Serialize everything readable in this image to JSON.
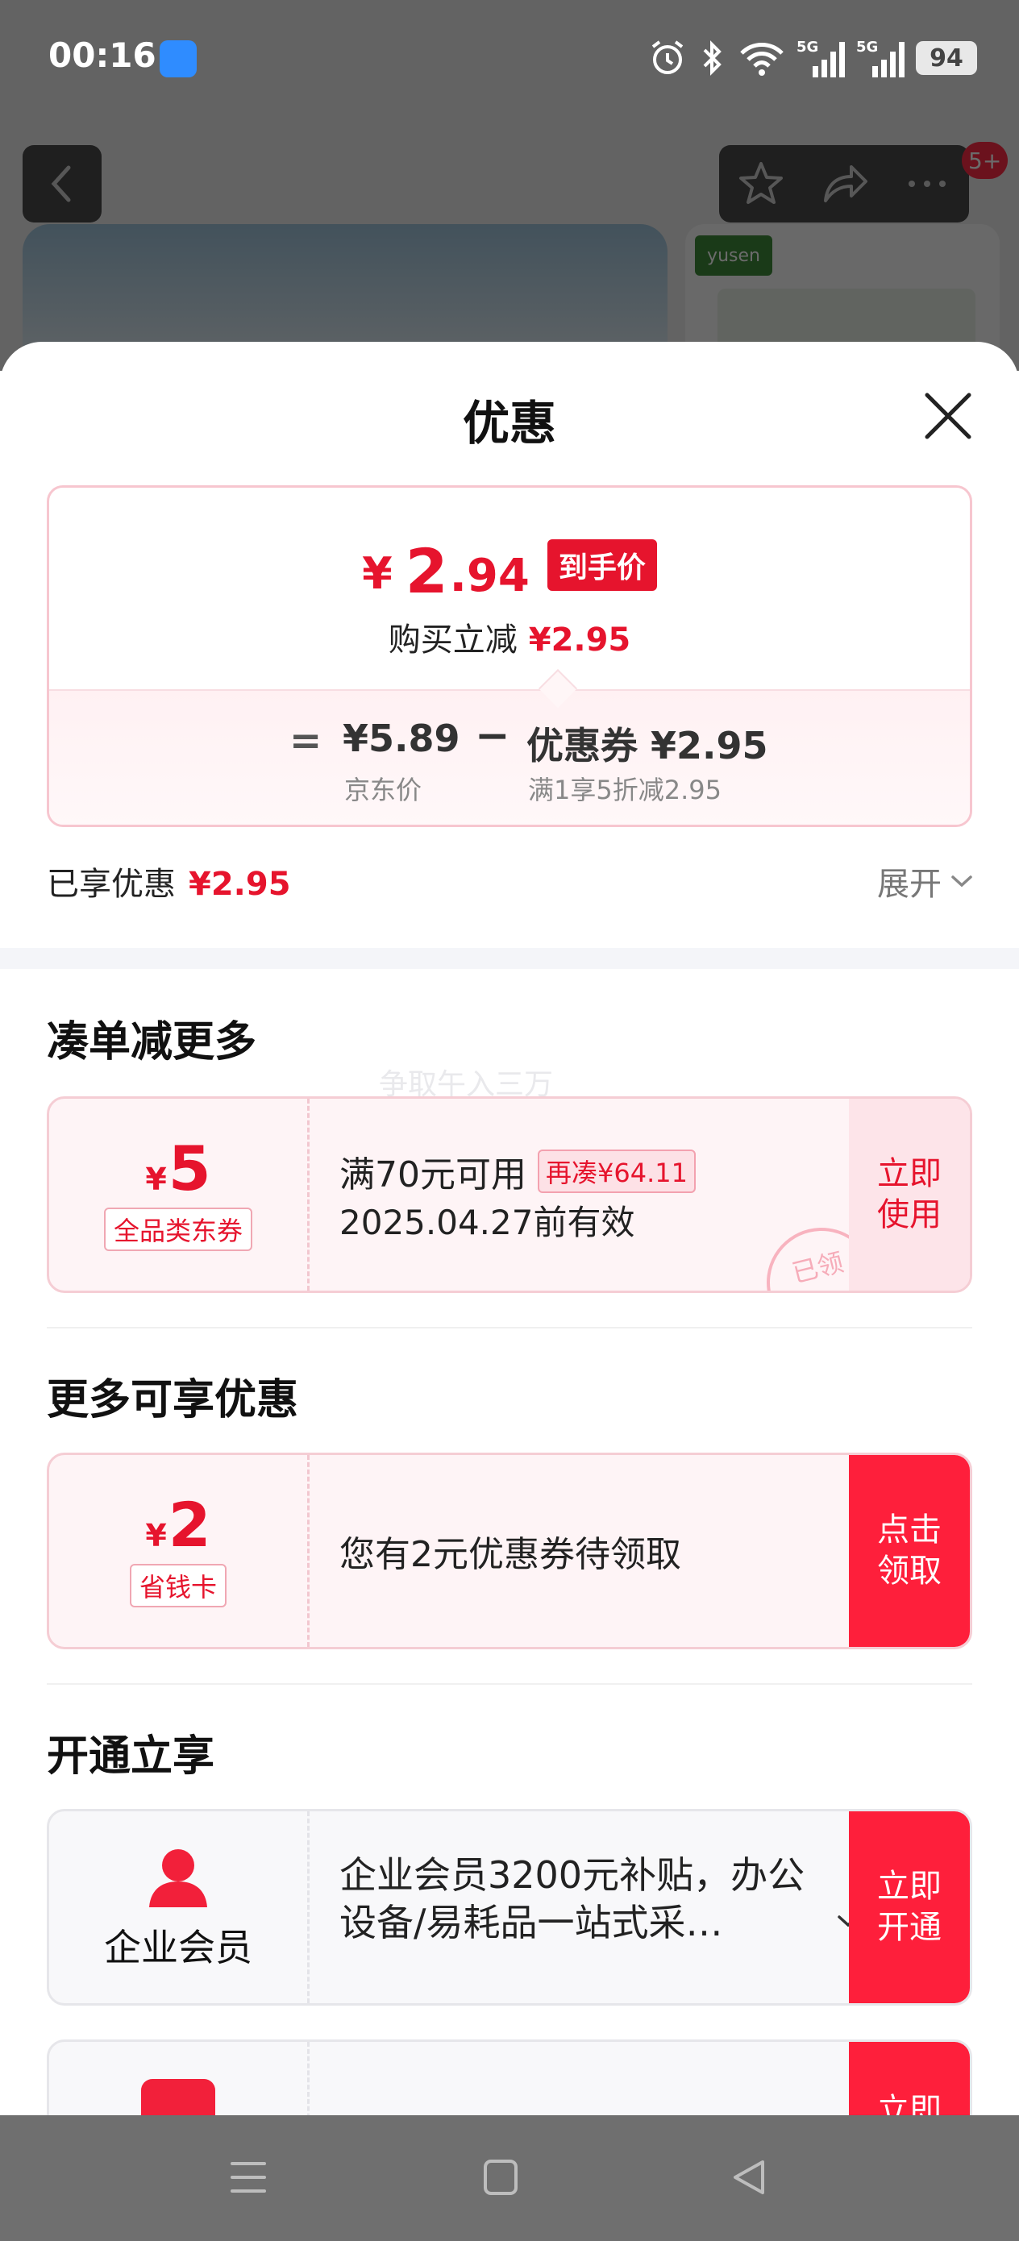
{
  "status_bar": {
    "time": "00:16",
    "network1": "5G",
    "network2": "5G",
    "battery": "94"
  },
  "background": {
    "cart_badge": "5+",
    "brand": "yusen"
  },
  "sheet": {
    "title": "优惠",
    "price": {
      "yen": "¥",
      "integer": "2",
      "decimal": ".94",
      "tag": "到手价"
    },
    "reduce": {
      "label": "购买立减",
      "amount": "¥2.95"
    },
    "formula": {
      "equals": "=",
      "jd_price": "¥5.89",
      "jd_label": "京东价",
      "minus": "−",
      "coupon_value": "优惠券 ¥2.95",
      "coupon_desc": "满1享5折减2.95"
    },
    "enjoyed": {
      "label": "已享优惠",
      "amount": "¥2.95"
    },
    "expand_label": "展开",
    "watermark": "争取午入三万",
    "section1": {
      "title": "凑单减更多",
      "coupon": {
        "yen": "¥",
        "amount": "5",
        "tag": "全品类东券",
        "condition": "满70元可用",
        "chip": "再凑¥64.11",
        "expiry": "2025.04.27前有效",
        "action": "立即\n使用",
        "stamp": "已领"
      }
    },
    "section2": {
      "title": "更多可享优惠",
      "coupon": {
        "yen": "¥",
        "amount": "2",
        "tag": "省钱卡",
        "text": "您有2元优惠券待领取",
        "action": "点击\n领取"
      }
    },
    "section3": {
      "title": "开通立享",
      "card": {
        "label": "企业会员",
        "text": "企业会员3200元补贴，办公设备/易耗品一站式采…",
        "action": "立即\n开通"
      },
      "card2": {
        "action": "立即"
      }
    }
  },
  "colors": {
    "accent": "#e6142d",
    "button_red": "#fe1f3b",
    "light_pink": "#fde4e9"
  }
}
